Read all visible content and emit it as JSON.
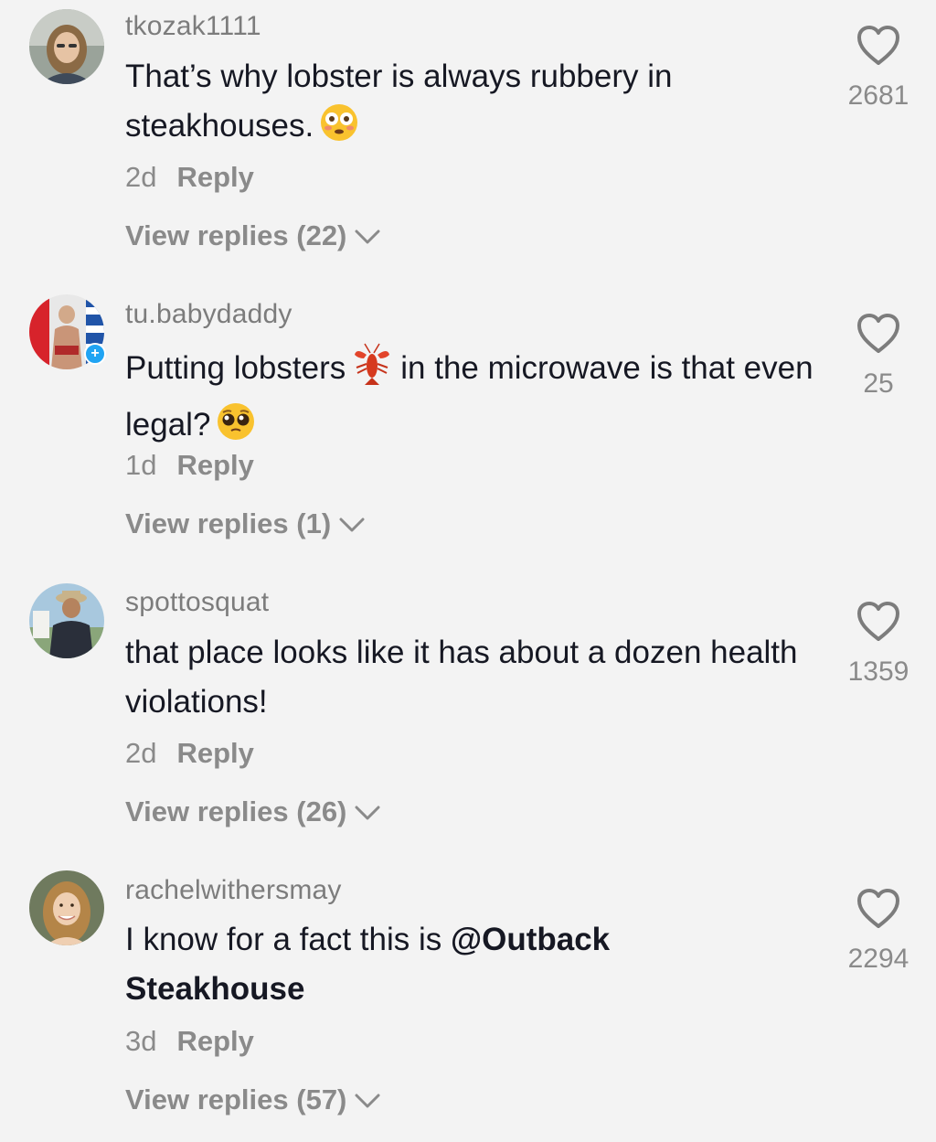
{
  "comments": [
    {
      "username": "tkozak1111",
      "text": "That’s why lobster is always rubbery in steakhouses.",
      "emoji": "flushed-face",
      "age": "2d",
      "reply_label": "Reply",
      "view_replies": "View replies (22)",
      "likes": "2681"
    },
    {
      "username": "tu.babydaddy",
      "text_before": "Putting lobsters",
      "inline_emoji": "lobster",
      "text_after": "in the microwave is that even legal?",
      "emoji": "pleading-face",
      "age": "1d",
      "reply_label": "Reply",
      "view_replies": "View replies (1)",
      "likes": "25"
    },
    {
      "username": "spottosquat",
      "text": "that place looks like it has about a dozen health violations!",
      "age": "2d",
      "reply_label": "Reply",
      "view_replies": "View replies (26)",
      "likes": "1359"
    },
    {
      "username": "rachelwithersmay",
      "text_before": "I know for a fact this is",
      "mention": "@Outback Steakhouse",
      "age": "3d",
      "reply_label": "Reply",
      "view_replies": "View replies (57)",
      "likes": "2294"
    }
  ],
  "colors": {
    "background": "#f3f3f3",
    "username": "#7c7c7c",
    "text": "#161823",
    "meta": "#8a8a8a",
    "verified": "#20a4f3"
  }
}
